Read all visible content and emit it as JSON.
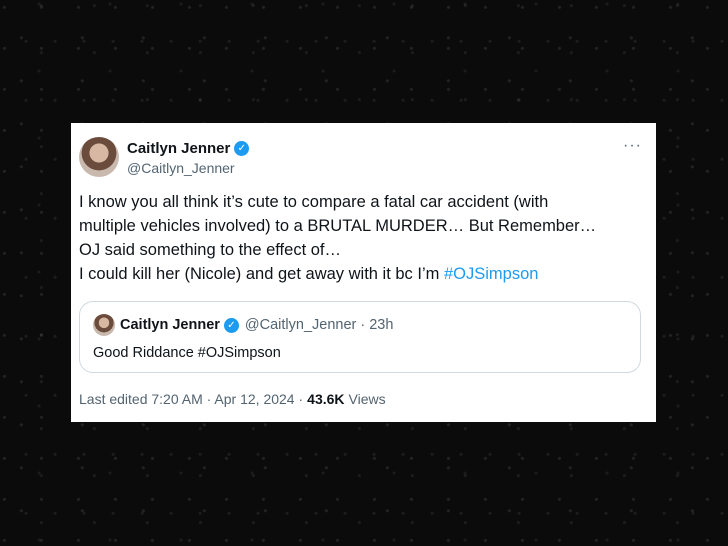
{
  "tweet": {
    "author_name": "Caitlyn Jenner",
    "author_handle": "@Caitlyn_Jenner",
    "verified_glyph": "✓",
    "more_glyph": "···",
    "lines": [
      "I know you all think it’s cute to compare a fatal car accident (with",
      "multiple vehicles involved) to a BRUTAL MURDER… But Remember…",
      "OJ said something to the effect of…"
    ],
    "last_line_text": "I could kill her (Nicole) and get away with it bc I’m ",
    "hashtag": "#OJSimpson",
    "footer": {
      "edited": "Last edited 7:20 AM · Apr 12, 2024 ·",
      "views_count": "43.6K",
      "views_label": "Views"
    }
  },
  "quoted_tweet": {
    "author_name": "Caitlyn Jenner",
    "verified_glyph": "✓",
    "meta": "@Caitlyn_Jenner · 23h",
    "text": "Good Riddance #OJSimpson"
  },
  "colors": {
    "accent": "#1d9bf0",
    "text": "#0f1419",
    "secondary": "#536471",
    "background": "#0b0b0b"
  }
}
